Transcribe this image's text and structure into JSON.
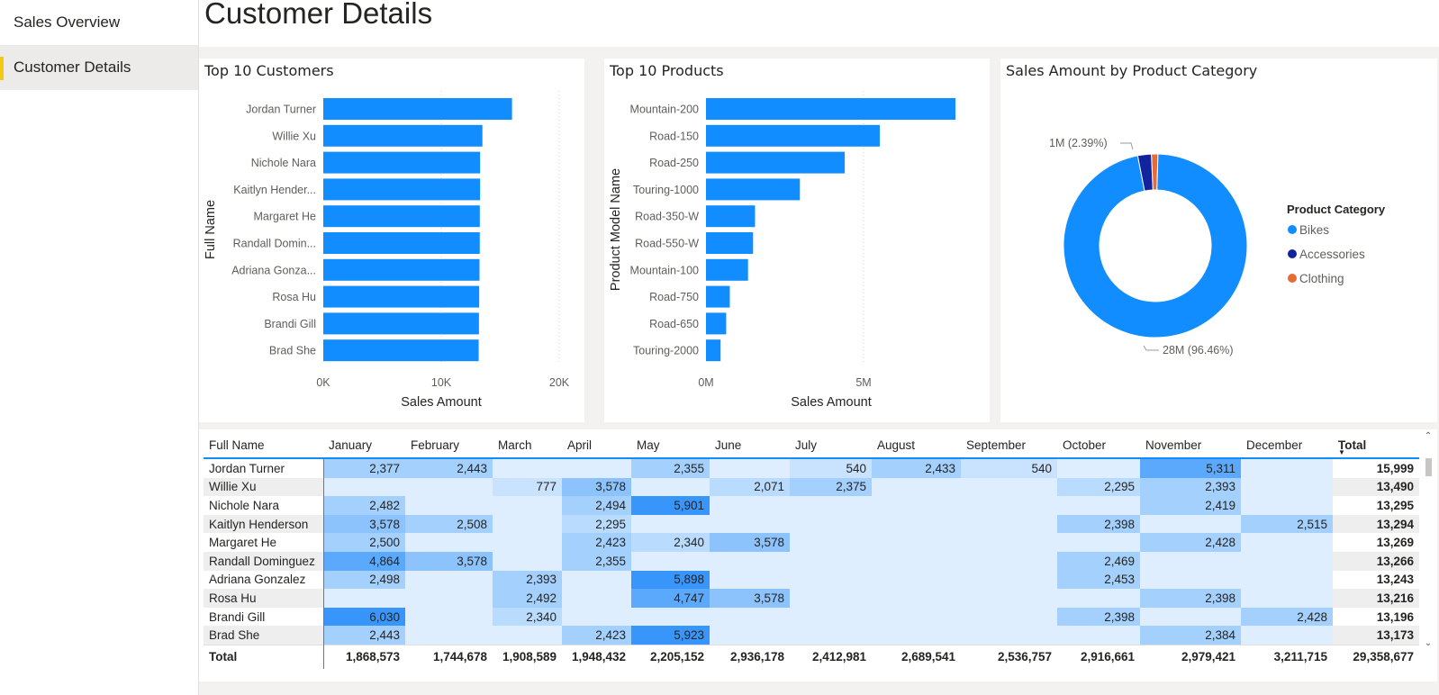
{
  "sidebar": {
    "items": [
      {
        "label": "Sales Overview"
      },
      {
        "label": "Customer Details"
      }
    ]
  },
  "page": {
    "title": "Customer Details"
  },
  "colors": {
    "accent": "#118dff",
    "nav_active_marker": "#f2c811",
    "bikes": "#118dff",
    "accessories": "#12239e",
    "clothing": "#e66c37"
  },
  "customers_chart": {
    "title": "Top 10 Customers",
    "chart_data": {
      "type": "bar",
      "orientation": "horizontal",
      "categories": [
        "Jordan Turner",
        "Willie Xu",
        "Nichole Nara",
        "Kaitlyn Hender...",
        "Margaret He",
        "Randall Domin...",
        "Adriana Gonza...",
        "Rosa Hu",
        "Brandi Gill",
        "Brad She"
      ],
      "values": [
        15999,
        13490,
        13295,
        13294,
        13269,
        13266,
        13243,
        13216,
        13196,
        13173
      ],
      "xlabel": "Sales Amount",
      "ylabel": "Full Name",
      "xlim": [
        0,
        20000
      ],
      "ticks": [
        "0K",
        "10K",
        "20K"
      ],
      "grid": true
    }
  },
  "products_chart": {
    "title": "Top 10 Products",
    "chart_data": {
      "type": "bar",
      "orientation": "horizontal",
      "categories": [
        "Mountain-200",
        "Road-150",
        "Road-250",
        "Touring-1000",
        "Road-350-W",
        "Road-550-W",
        "Mountain-100",
        "Road-750",
        "Road-650",
        "Touring-2000"
      ],
      "values": [
        8900000,
        6200000,
        4950000,
        3350000,
        1750000,
        1680000,
        1500000,
        850000,
        720000,
        520000
      ],
      "xlabel": "Sales Amount",
      "ylabel": "Product Model Name",
      "xlim": [
        0,
        8900000
      ],
      "ticks": [
        "0M",
        "5M"
      ],
      "grid": true
    }
  },
  "category_chart": {
    "title": "Sales Amount by Product Category",
    "chart_data": {
      "type": "pie",
      "donut": true,
      "categories": [
        "Bikes",
        "Accessories",
        "Clothing"
      ],
      "values": [
        96.46,
        2.39,
        1.15
      ],
      "labels": [
        "28M (96.46%)",
        "1M (2.39%)"
      ],
      "legend_title": "Product Category",
      "legend_position": "right"
    }
  },
  "table": {
    "columns": [
      "Full Name",
      "January",
      "February",
      "March",
      "April",
      "May",
      "June",
      "July",
      "August",
      "September",
      "October",
      "November",
      "December",
      "Total"
    ],
    "rows": [
      {
        "name": "Jordan Turner",
        "values": [
          "2,377",
          "2,443",
          "",
          "",
          "2,355",
          "",
          "540",
          "2,433",
          "540",
          "",
          "5,311",
          ""
        ],
        "total": "15,999"
      },
      {
        "name": "Willie Xu",
        "values": [
          "",
          "",
          "777",
          "3,578",
          "",
          "2,071",
          "2,375",
          "",
          "",
          "2,295",
          "2,393",
          ""
        ],
        "total": "13,490"
      },
      {
        "name": "Nichole Nara",
        "values": [
          "2,482",
          "",
          "",
          "2,494",
          "5,901",
          "",
          "",
          "",
          "",
          "",
          "2,419",
          ""
        ],
        "total": "13,295"
      },
      {
        "name": "Kaitlyn Henderson",
        "values": [
          "3,578",
          "2,508",
          "",
          "2,295",
          "",
          "",
          "",
          "",
          "",
          "2,398",
          "",
          "2,515"
        ],
        "total": "13,294"
      },
      {
        "name": "Margaret He",
        "values": [
          "2,500",
          "",
          "",
          "2,423",
          "2,340",
          "3,578",
          "",
          "",
          "",
          "",
          "2,428",
          ""
        ],
        "total": "13,269"
      },
      {
        "name": "Randall Dominguez",
        "values": [
          "4,864",
          "3,578",
          "",
          "2,355",
          "",
          "",
          "",
          "",
          "",
          "2,469",
          "",
          ""
        ],
        "total": "13,266"
      },
      {
        "name": "Adriana Gonzalez",
        "values": [
          "2,498",
          "",
          "2,393",
          "",
          "5,898",
          "",
          "",
          "",
          "",
          "2,453",
          "",
          ""
        ],
        "total": "13,243"
      },
      {
        "name": "Rosa Hu",
        "values": [
          "",
          "",
          "2,492",
          "",
          "4,747",
          "3,578",
          "",
          "",
          "",
          "",
          "2,398",
          ""
        ],
        "total": "13,216"
      },
      {
        "name": "Brandi Gill",
        "values": [
          "6,030",
          "",
          "2,340",
          "",
          "",
          "",
          "",
          "",
          "",
          "2,398",
          "",
          "2,428"
        ],
        "total": "13,196"
      },
      {
        "name": "Brad She",
        "values": [
          "2,443",
          "",
          "",
          "2,423",
          "5,923",
          "",
          "",
          "",
          "",
          "",
          "2,384",
          ""
        ],
        "total": "13,173"
      }
    ],
    "totals": {
      "label": "Total",
      "values": [
        "1,868,573",
        "1,744,678",
        "1,908,589",
        "1,948,432",
        "2,205,152",
        "2,936,178",
        "2,412,981",
        "2,689,541",
        "2,536,757",
        "2,916,661",
        "2,979,421",
        "3,211,715"
      ],
      "grand": "29,358,677"
    }
  }
}
